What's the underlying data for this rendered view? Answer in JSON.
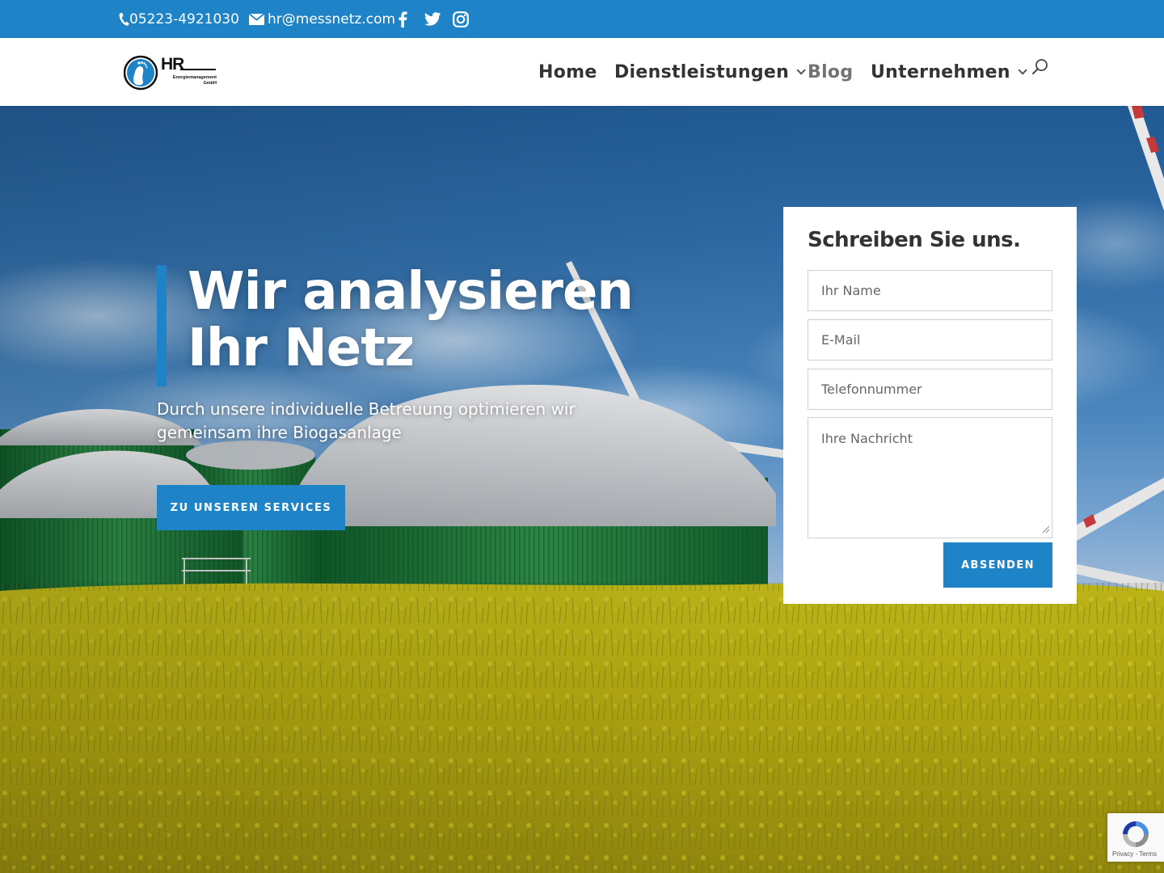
{
  "topbar": {
    "phone": "05223-4921030",
    "email": "hr@messnetz.com",
    "social": [
      "facebook-icon",
      "twitter-icon",
      "instagram-icon"
    ]
  },
  "header": {
    "logo": {
      "title": "HR",
      "subtitle_line1": "Energiemanagement",
      "subtitle_line2": "GmbH"
    },
    "nav": {
      "home": "Home",
      "dienstleistungen": "Dienstleistungen",
      "blog": "Blog",
      "unternehmen": "Unternehmen"
    }
  },
  "hero": {
    "title_line1": "Wir analysieren",
    "title_line2": "Ihr Netz",
    "subtitle": "Durch unsere individuelle Betreuung optimieren wir gemeinsam ihre Biogasanlage",
    "cta": "ZU UNSEREN SERVICES"
  },
  "contact_form": {
    "title": "Schreiben Sie uns.",
    "name_placeholder": "Ihr Name",
    "email_placeholder": "E-Mail",
    "phone_placeholder": "Telefonnummer",
    "message_placeholder": "Ihre Nachricht",
    "submit": "ABSENDEN"
  },
  "recaptcha": {
    "text": "Privacy - Terms"
  },
  "colors": {
    "primary": "#1f83c8",
    "text_dark": "#333333",
    "nav_active": "#737373"
  }
}
